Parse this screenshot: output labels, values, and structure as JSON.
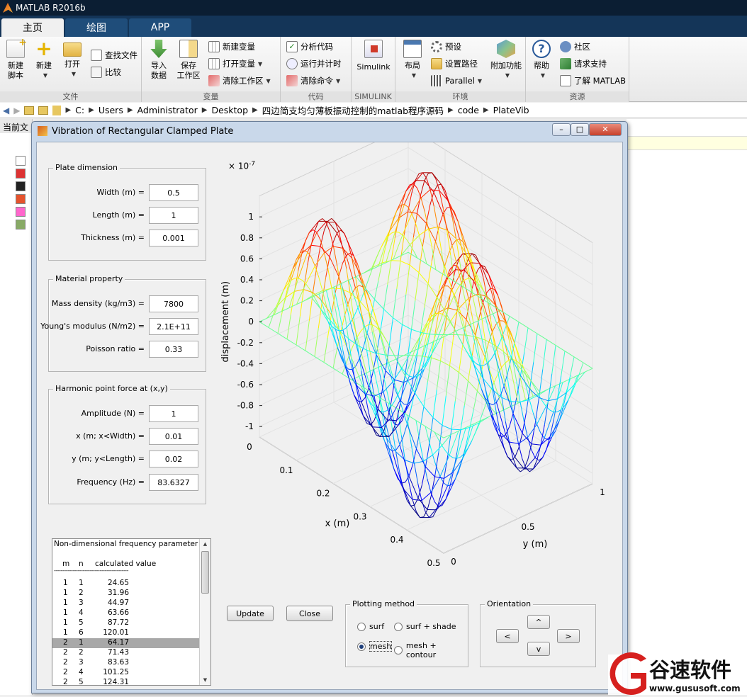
{
  "app": {
    "title": "MATLAB R2016b"
  },
  "ribbon_tabs": [
    {
      "label": "主页",
      "active": true
    },
    {
      "label": "绘图",
      "active": false
    },
    {
      "label": "APP",
      "active": false
    }
  ],
  "ribbon": {
    "file": {
      "group_label": "文件",
      "new_script": [
        "新建",
        "脚本"
      ],
      "new": "新建",
      "open": "打开",
      "find_files": "查找文件",
      "compare": "比较"
    },
    "variable": {
      "group_label": "变量",
      "import": [
        "导入",
        "数据"
      ],
      "save_workspace": [
        "保存",
        "工作区"
      ],
      "new_variable": "新建变量",
      "open_variable": "打开变量",
      "clear_workspace": "清除工作区"
    },
    "code": {
      "group_label": "代码",
      "analyze": "分析代码",
      "run_time": "运行并计时",
      "clear_commands": "清除命令"
    },
    "simulink": {
      "group_label": "SIMULINK",
      "label": "Simulink"
    },
    "environment": {
      "group_label": "环境",
      "layout": "布局",
      "preferences": "预设",
      "set_path": "设置路径",
      "parallel": "Parallel",
      "addons": "附加功能"
    },
    "resources": {
      "group_label": "资源",
      "help": "帮助",
      "community": "社区",
      "support": "请求支持",
      "learn": "了解 MATLAB"
    }
  },
  "address_bar": {
    "path": [
      "C:",
      "Users",
      "Administrator",
      "Desktop",
      "四边简支均匀薄板振动控制的matlab程序源码",
      "code",
      "PlateVib"
    ]
  },
  "left_panel": {
    "header": "当前文"
  },
  "figure_window": {
    "title": "Vibration of Rectangular Clamped Plate",
    "plate_dimension": {
      "title": "Plate dimension",
      "fields": [
        {
          "label": "Width (m) =",
          "value": "0.5"
        },
        {
          "label": "Length (m) =",
          "value": "1"
        },
        {
          "label": "Thickness (m) =",
          "value": "0.001"
        }
      ]
    },
    "material_property": {
      "title": "Material property",
      "fields": [
        {
          "label": "Mass density (kg/m3) =",
          "value": "7800"
        },
        {
          "label": "Young's modulus (N/m2) =",
          "value": "2.1E+11"
        },
        {
          "label": "Poisson ratio =",
          "value": "0.33"
        }
      ]
    },
    "harmonic_force": {
      "title": "Harmonic point force at (x,y)",
      "fields": [
        {
          "label": "Amplitude (N) =",
          "value": "1"
        },
        {
          "label": "x (m; x<Width) =",
          "value": "0.01"
        },
        {
          "label": "y (m; y<Length) =",
          "value": "0.02"
        },
        {
          "label": "Frequency (Hz) =",
          "value": "83.6327"
        }
      ]
    },
    "frequency_list": {
      "title_line": "Non-dimensional frequency parameter",
      "header_m": "m",
      "header_n": "n",
      "header_value": "calculated value",
      "divider": "--------------------------------------------",
      "rows": [
        {
          "m": "1",
          "n": "1",
          "v": "24.65"
        },
        {
          "m": "1",
          "n": "2",
          "v": "31.96"
        },
        {
          "m": "1",
          "n": "3",
          "v": "44.97"
        },
        {
          "m": "1",
          "n": "4",
          "v": "63.66"
        },
        {
          "m": "1",
          "n": "5",
          "v": "87.72"
        },
        {
          "m": "1",
          "n": "6",
          "v": "120.01"
        },
        {
          "m": "2",
          "n": "1",
          "v": "64.17",
          "selected": true
        },
        {
          "m": "2",
          "n": "2",
          "v": "71.43"
        },
        {
          "m": "2",
          "n": "3",
          "v": "83.63"
        },
        {
          "m": "2",
          "n": "4",
          "v": "101.25"
        },
        {
          "m": "2",
          "n": "5",
          "v": "124.31"
        }
      ]
    },
    "buttons": {
      "update": "Update",
      "close": "Close"
    },
    "plotting_method": {
      "title": "Plotting method",
      "options": [
        {
          "label": "surf",
          "checked": false
        },
        {
          "label": "surf + shade",
          "checked": false
        },
        {
          "label": "mesh",
          "checked": true
        },
        {
          "label": "mesh + contour",
          "checked": false
        }
      ]
    },
    "orientation": {
      "title": "Orientation",
      "up": "^",
      "down": "v",
      "left": "<",
      "right": ">"
    }
  },
  "chart_data": {
    "type": "mesh",
    "zlabel": "displacement (m)",
    "xlabel": "x (m)",
    "ylabel": "y (m)",
    "z_exponent": "× 10^-7",
    "z_exponent_base": "× 10",
    "z_exponent_power": "-7",
    "z_ticks": [
      "1",
      "0.8",
      "0.6",
      "0.4",
      "0.2",
      "0",
      "-0.2",
      "-0.4",
      "-0.6",
      "-0.8",
      "-1"
    ],
    "x_ticks": [
      "0",
      "0.1",
      "0.2",
      "0.3",
      "0.4",
      "0.5"
    ],
    "y_ticks": [
      "0",
      "0.5",
      "1"
    ],
    "xlim": [
      0,
      0.5
    ],
    "ylim": [
      0,
      1
    ],
    "zlim": [
      -1.1,
      1.2
    ],
    "grid": true,
    "surface": "mode (m=2, n=3): w(x,y) ≈ 1.15e-7 · sin(2πx/0.5) · sin(3πy/1)",
    "colormap": "jet"
  },
  "watermark": {
    "brand": "谷速软件",
    "url": "www.gususoft.com"
  }
}
